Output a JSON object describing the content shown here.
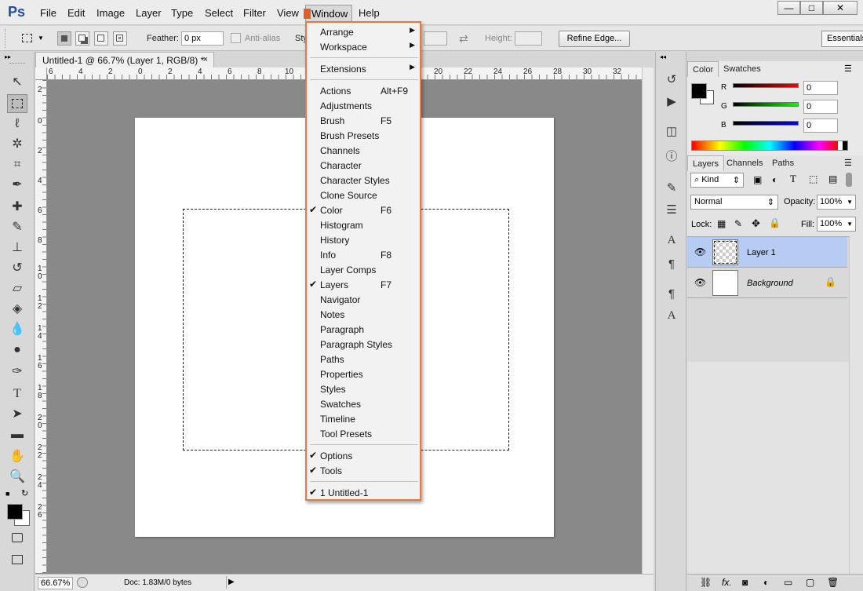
{
  "app": {
    "logo": "Ps"
  },
  "menubar": {
    "items": [
      "File",
      "Edit",
      "Image",
      "Layer",
      "Type",
      "Select",
      "Filter",
      "View",
      "Window",
      "Help"
    ]
  },
  "window_controls": {
    "minimize": "—",
    "maximize": "□",
    "close": "✕"
  },
  "options_bar": {
    "feather_label": "Feather:",
    "feather_value": "0 px",
    "antialias_label": "Anti-alias",
    "style_label": "Sty",
    "height_label": "Height:",
    "refine_label": "Refine Edge...",
    "workspace_label": "Essentials"
  },
  "document": {
    "tab_title": "Untitled-1 @ 66.7% (Layer 1, RGB/8) *",
    "close": "×",
    "zoom": "66.67%",
    "doc_info": "Doc: 1.83M/0 bytes"
  },
  "rulers": {
    "top": [
      "6",
      "4",
      "2",
      "0",
      "2",
      "4",
      "6",
      "8",
      "10",
      "20",
      "22",
      "24",
      "26",
      "28",
      "30",
      "32"
    ],
    "left": [
      "2",
      "0",
      "2",
      "4",
      "6",
      "8",
      "1\n0",
      "1\n2",
      "1\n4",
      "1\n6",
      "1\n8",
      "2\n0",
      "2\n2",
      "2\n4",
      "2\n6"
    ]
  },
  "window_menu": {
    "items": [
      {
        "label": "Arrange",
        "submenu": true
      },
      {
        "label": "Workspace",
        "submenu": true
      },
      {
        "sep": true
      },
      {
        "label": "Extensions",
        "submenu": true
      },
      {
        "sep": true
      },
      {
        "label": "Actions",
        "shortcut": "Alt+F9"
      },
      {
        "label": "Adjustments"
      },
      {
        "label": "Brush",
        "shortcut": "F5"
      },
      {
        "label": "Brush Presets"
      },
      {
        "label": "Channels"
      },
      {
        "label": "Character"
      },
      {
        "label": "Character Styles"
      },
      {
        "label": "Clone Source"
      },
      {
        "label": "Color",
        "shortcut": "F6",
        "checked": true
      },
      {
        "label": "Histogram"
      },
      {
        "label": "History"
      },
      {
        "label": "Info",
        "shortcut": "F8"
      },
      {
        "label": "Layer Comps"
      },
      {
        "label": "Layers",
        "shortcut": "F7",
        "checked": true
      },
      {
        "label": "Navigator"
      },
      {
        "label": "Notes"
      },
      {
        "label": "Paragraph"
      },
      {
        "label": "Paragraph Styles"
      },
      {
        "label": "Paths"
      },
      {
        "label": "Properties"
      },
      {
        "label": "Styles"
      },
      {
        "label": "Swatches"
      },
      {
        "label": "Timeline"
      },
      {
        "label": "Tool Presets"
      },
      {
        "sep": true
      },
      {
        "label": "Options",
        "checked": true
      },
      {
        "label": "Tools",
        "checked": true
      },
      {
        "sep": true
      },
      {
        "label": "1 Untitled-1",
        "checked": true
      }
    ]
  },
  "color_panel": {
    "tabs": [
      "Color",
      "Swatches"
    ],
    "r_label": "R",
    "g_label": "G",
    "b_label": "B",
    "r": "0",
    "g": "0",
    "b": "0"
  },
  "layers_panel": {
    "tabs": [
      "Layers",
      "Channels",
      "Paths"
    ],
    "kind_label": "Kind",
    "blend_mode": "Normal",
    "opacity_label": "Opacity:",
    "opacity": "100%",
    "lock_label": "Lock:",
    "fill_label": "Fill:",
    "fill": "100%",
    "layers": [
      {
        "name": "Layer 1",
        "selected": true
      },
      {
        "name": "Background",
        "locked": true
      }
    ]
  },
  "colors": {
    "accent": "#e87a3c",
    "selection": "#b6ccf2",
    "canvas_bg": "#898989"
  }
}
